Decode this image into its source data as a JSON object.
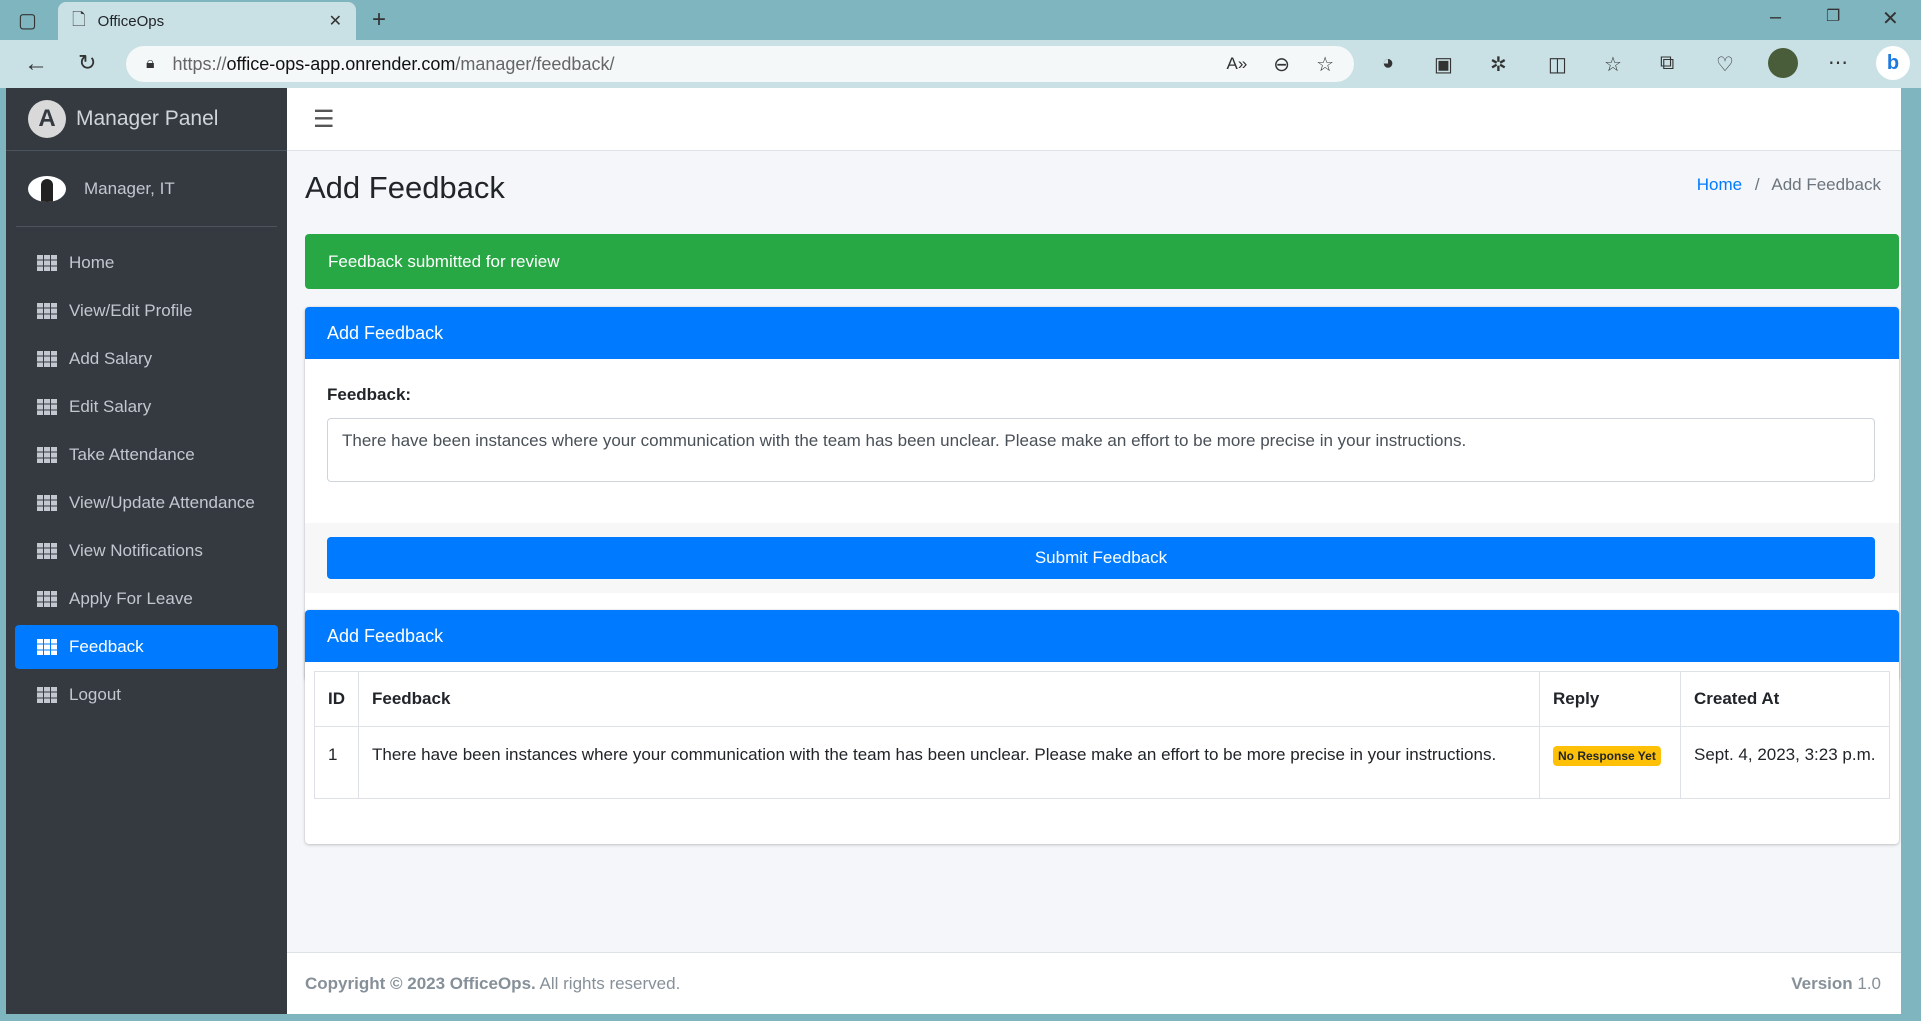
{
  "browser": {
    "tab_title": "OfficeOps",
    "url_scheme": "https://",
    "url_host": "office-ops-app.onrender.com",
    "url_path": "/manager/feedback/"
  },
  "sidebar": {
    "brand": "Manager Panel",
    "user": "Manager, IT",
    "items": [
      {
        "label": "Home"
      },
      {
        "label": "View/Edit Profile"
      },
      {
        "label": "Add Salary"
      },
      {
        "label": "Edit Salary"
      },
      {
        "label": "Take Attendance"
      },
      {
        "label": "View/Update Attendance"
      },
      {
        "label": "View Notifications"
      },
      {
        "label": "Apply For Leave"
      },
      {
        "label": "Feedback",
        "active": true
      },
      {
        "label": "Logout"
      }
    ]
  },
  "page": {
    "title": "Add Feedback",
    "breadcrumb": {
      "home": "Home",
      "sep": "/",
      "current": "Add Feedback"
    }
  },
  "alert": {
    "text": "Feedback submitted for review",
    "color": "#28a745"
  },
  "form": {
    "card_title": "Add Feedback",
    "label": "Feedback:",
    "value": "There have been instances where your communication with the team has been unclear. Please make an effort to be more precise in your instructions.",
    "submit": "Submit Feedback"
  },
  "table": {
    "card_title": "Add Feedback",
    "headers": [
      "ID",
      "Feedback",
      "Reply",
      "Created At"
    ],
    "rows": [
      {
        "id": "1",
        "feedback": "There have been instances where your communication with the team has been unclear. Please make an effort to be more precise in your instructions.",
        "reply": "No Response Yet",
        "created": "Sept. 4, 2023, 3:23 p.m."
      }
    ]
  },
  "footer": {
    "copyright_bold": "Copyright © 2023 OfficeOps.",
    "copyright_rest": " All rights reserved.",
    "version_label": "Version",
    "version": " 1.0"
  },
  "colors": {
    "primary": "#007bff",
    "sidebar": "#343a40",
    "badge": "#ffc107"
  }
}
